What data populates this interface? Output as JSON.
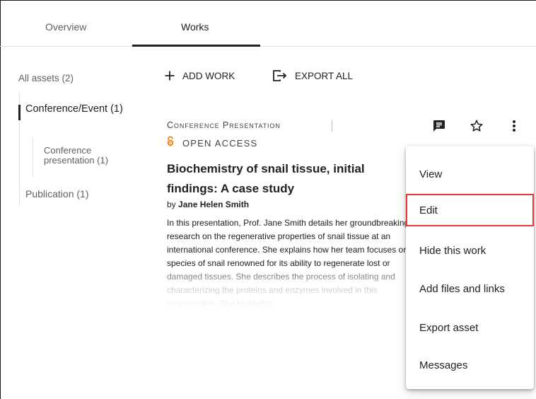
{
  "tabs": [
    {
      "label": "Overview"
    },
    {
      "label": "Works"
    }
  ],
  "filters": {
    "all": "All assets (2)",
    "conference_event": "Conference/Event (1)",
    "conference_presentation": "Conference presentation (1)",
    "publication": "Publication (1)"
  },
  "toolbar": {
    "add_work": "ADD WORK",
    "export_all": "EXPORT ALL"
  },
  "work": {
    "type": "Conference Presentation",
    "access": "OPEN ACCESS",
    "title": "Biochemistry of snail tissue, initial findings: A case study",
    "by_prefix": "by",
    "author": "Jane Helen Smith",
    "description": "In this presentation, Prof. Jane Smith details her groundbreaking research on the regenerative properties of snail tissue at an international conference. She explains how her team focuses on a species of snail renowned for its ability to regenerate lost or damaged tissues. She describes the process of isolating and characterizing the proteins and enzymes involved in this regeneration. She highlights"
  },
  "menu": {
    "view": "View",
    "edit": "Edit",
    "hide": "Hide this work",
    "add_files": "Add files and links",
    "export": "Export asset",
    "messages": "Messages"
  },
  "colors": {
    "accent_text": "#212121",
    "open_access": "#f57c00",
    "highlight_border": "#e53935"
  },
  "icons": [
    "add-icon",
    "export-icon",
    "open-access-icon",
    "comment-icon",
    "star-outline-icon",
    "more-vert-icon"
  ]
}
